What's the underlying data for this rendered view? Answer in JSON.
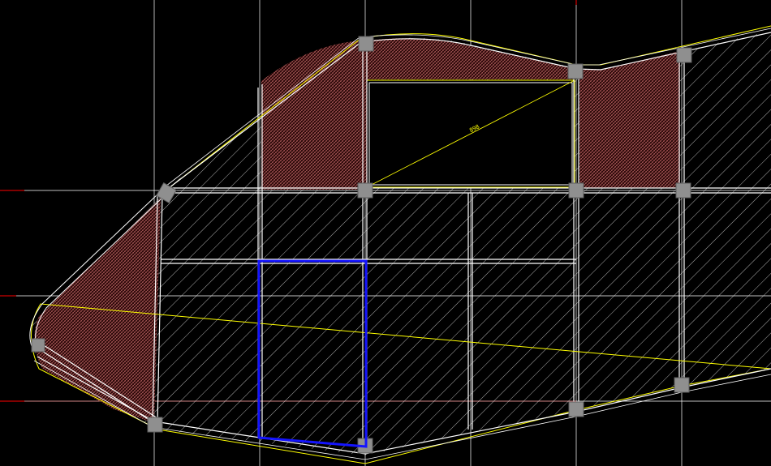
{
  "drawing": {
    "dimension_label": "898",
    "colors": {
      "background": "#000000",
      "grid_axis": "#ffffff",
      "axis_marker": "#ff0000",
      "outline": "#ffff00",
      "beam": "#ffffff",
      "column": "#8f8f8f",
      "hatch_slab": "#ffffff",
      "hatch_dense": "#d97a7a",
      "selection": "#1414ff"
    },
    "layers": [
      "grid-axes",
      "slab-hatch",
      "dense-hatch",
      "beams",
      "columns",
      "slab-outline",
      "opening",
      "selection"
    ]
  }
}
